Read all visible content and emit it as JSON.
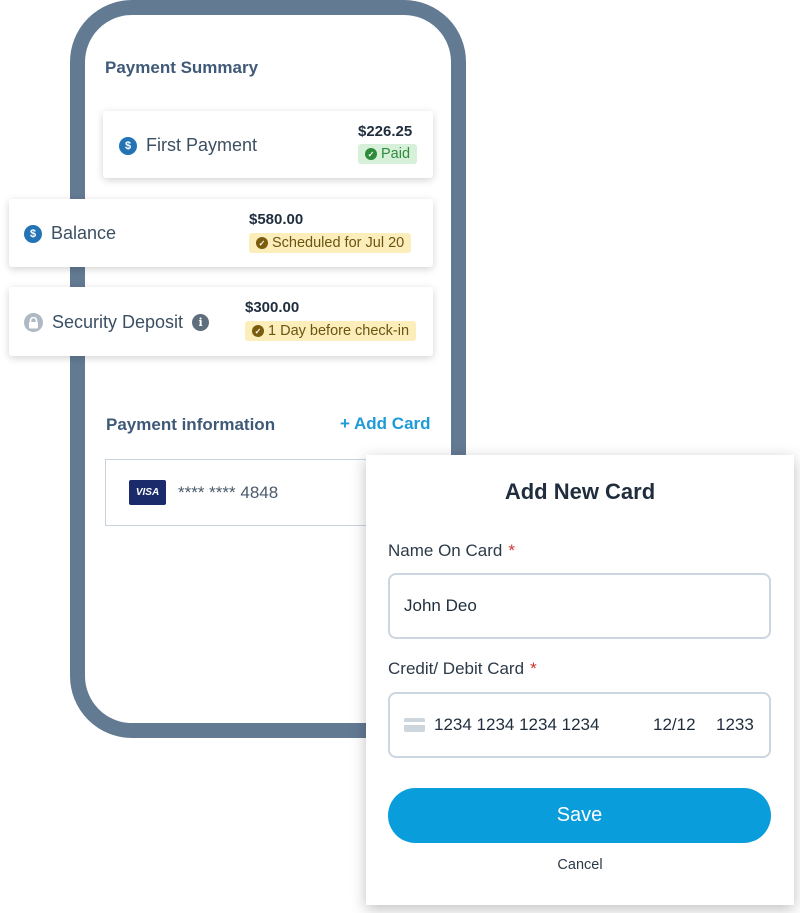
{
  "summary": {
    "title": "Payment Summary",
    "items": [
      {
        "label": "First Payment",
        "amount": "$226.25",
        "status": "Paid",
        "icon": "dollar-icon"
      },
      {
        "label": "Balance",
        "amount": "$580.00",
        "status": "Scheduled for Jul 20",
        "icon": "dollar-icon"
      },
      {
        "label": "Security Deposit",
        "amount": "$300.00",
        "status": "1 Day before check-in",
        "icon": "lock-icon"
      }
    ]
  },
  "payment_info": {
    "title": "Payment information",
    "add_card_label": "+ Add Card",
    "saved_card": {
      "brand": "VISA",
      "masked_number": "**** **** 4848"
    }
  },
  "modal": {
    "title": "Add New Card",
    "name_label": "Name On Card",
    "name_value": "John Deo",
    "card_label": "Credit/ Debit Card",
    "card_number": "1234 1234 1234 1234",
    "card_expiry": "12/12",
    "card_cvc": "1233",
    "required_mark": "*",
    "save_label": "Save",
    "cancel_label": "Cancel"
  },
  "colors": {
    "phone_frame": "#637a93",
    "accent": "#0a9ddc",
    "paid_badge": "#d7f0da",
    "scheduled_badge": "#fbeebb"
  }
}
